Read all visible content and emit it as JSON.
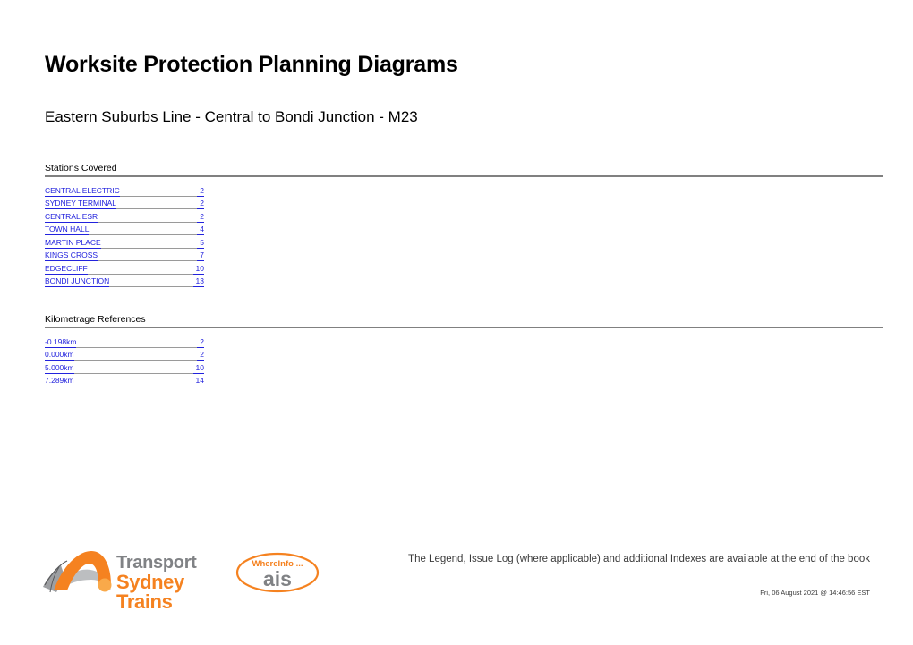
{
  "document": {
    "title": "Worksite Protection Planning Diagrams",
    "subtitle": "Eastern Suburbs Line - Central to Bondi Junction - M23"
  },
  "sections": {
    "stations": {
      "heading": "Stations Covered",
      "entries": [
        {
          "label": "CENTRAL ELECTRIC",
          "page": "2"
        },
        {
          "label": "SYDNEY TERMINAL",
          "page": "2"
        },
        {
          "label": "CENTRAL ESR",
          "page": "2"
        },
        {
          "label": "TOWN HALL",
          "page": "4"
        },
        {
          "label": "MARTIN PLACE",
          "page": "5"
        },
        {
          "label": "KINGS CROSS",
          "page": "7"
        },
        {
          "label": "EDGECLIFF",
          "page": "10"
        },
        {
          "label": "BONDI JUNCTION",
          "page": "13"
        }
      ]
    },
    "kilometrage": {
      "heading": "Kilometrage References",
      "entries": [
        {
          "label": "-0.198km",
          "page": "2"
        },
        {
          "label": "0.000km",
          "page": "2"
        },
        {
          "label": "5.000km",
          "page": "10"
        },
        {
          "label": "7.289km",
          "page": "14"
        }
      ]
    }
  },
  "branding": {
    "transport_word": "Transport",
    "agency_word": "Sydney Trains",
    "ais_top_text": "WhereInfo ...",
    "ais_main_text": "ais"
  },
  "footer": {
    "note": "The Legend, Issue Log (where applicable) and additional Indexes are available at the end of the book",
    "timestamp": "Fri, 06 August 2021 @ 14:46:56 EST"
  },
  "colors": {
    "link": "#2222dd",
    "rule": "#808080",
    "brand_orange": "#f58220",
    "brand_grey": "#808285"
  }
}
